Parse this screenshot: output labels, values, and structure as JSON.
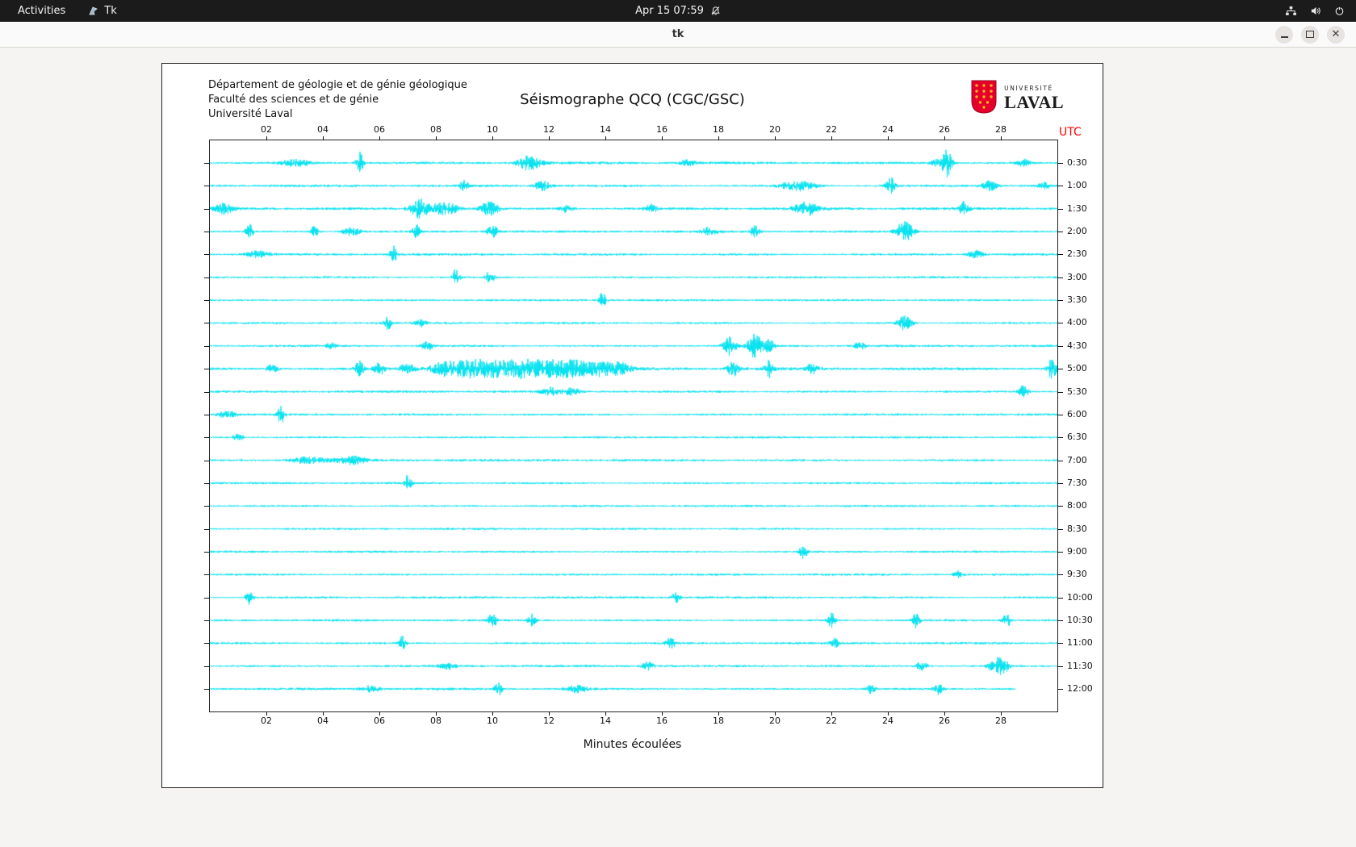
{
  "topbar": {
    "activities_label": "Activities",
    "app_menu_label": "Tk",
    "clock_label": "Apr 15 07:59"
  },
  "titlebar": {
    "title": "tk"
  },
  "seismograph": {
    "header_lines": [
      "Département de géologie et de génie géologique",
      "Faculté des sciences et de génie",
      "Université Laval"
    ],
    "title": "Séismographe QCQ (CGC/GSC)",
    "utc_label": "UTC",
    "x_axis_label": "Minutes écoulées",
    "x_ticks": [
      "02",
      "04",
      "06",
      "08",
      "10",
      "12",
      "14",
      "16",
      "18",
      "20",
      "22",
      "24",
      "26",
      "28"
    ],
    "trace_color": "#00e1ef",
    "logo": {
      "top_text": "UNIVERSITÉ",
      "bottom_text": "LAVAL"
    },
    "rows": [
      {
        "label": "0:30",
        "noise": 1.1,
        "end": 30,
        "spikes": [
          [
            3.0,
            4,
            0.5
          ],
          [
            5.3,
            14,
            0.12
          ],
          [
            11.3,
            9,
            0.4
          ],
          [
            16.9,
            3,
            0.3
          ],
          [
            25.9,
            7,
            0.3
          ],
          [
            26.1,
            12,
            0.15
          ],
          [
            28.8,
            5,
            0.2
          ]
        ]
      },
      {
        "label": "1:00",
        "noise": 1.0,
        "end": 30,
        "spikes": [
          [
            9.0,
            7,
            0.15
          ],
          [
            11.8,
            6,
            0.3
          ],
          [
            20.8,
            6,
            0.6
          ],
          [
            24.1,
            10,
            0.15
          ],
          [
            27.6,
            6,
            0.25
          ],
          [
            29.5,
            4,
            0.2
          ]
        ]
      },
      {
        "label": "1:30",
        "noise": 1.15,
        "end": 30,
        "spikes": [
          [
            0.5,
            6,
            0.3
          ],
          [
            7.4,
            12,
            0.3
          ],
          [
            8.3,
            8,
            0.5
          ],
          [
            9.9,
            9,
            0.3
          ],
          [
            12.6,
            5,
            0.25
          ],
          [
            15.6,
            5,
            0.2
          ],
          [
            21.1,
            8,
            0.4
          ],
          [
            26.7,
            9,
            0.15
          ]
        ]
      },
      {
        "label": "2:00",
        "noise": 1.0,
        "end": 30,
        "spikes": [
          [
            1.4,
            9,
            0.12
          ],
          [
            3.7,
            7,
            0.12
          ],
          [
            5.0,
            5,
            0.3
          ],
          [
            7.3,
            9,
            0.12
          ],
          [
            10.0,
            8,
            0.2
          ],
          [
            17.7,
            5,
            0.25
          ],
          [
            19.3,
            7,
            0.15
          ],
          [
            24.6,
            12,
            0.3
          ]
        ]
      },
      {
        "label": "2:30",
        "noise": 1.0,
        "end": 30,
        "spikes": [
          [
            1.7,
            4,
            0.4
          ],
          [
            6.5,
            10,
            0.12
          ],
          [
            27.1,
            5,
            0.25
          ]
        ]
      },
      {
        "label": "3:00",
        "noise": 0.9,
        "end": 30,
        "spikes": [
          [
            8.7,
            11,
            0.12
          ],
          [
            9.9,
            7,
            0.15
          ]
        ]
      },
      {
        "label": "3:30",
        "noise": 0.9,
        "end": 30,
        "spikes": [
          [
            13.9,
            10,
            0.12
          ]
        ]
      },
      {
        "label": "4:00",
        "noise": 0.9,
        "end": 30,
        "spikes": [
          [
            6.3,
            8,
            0.12
          ],
          [
            7.5,
            4,
            0.2
          ],
          [
            24.6,
            9,
            0.25
          ]
        ]
      },
      {
        "label": "4:30",
        "noise": 0.95,
        "end": 30,
        "spikes": [
          [
            4.3,
            5,
            0.15
          ],
          [
            7.7,
            5,
            0.2
          ],
          [
            18.4,
            13,
            0.2
          ],
          [
            19.3,
            15,
            0.25
          ],
          [
            19.8,
            9,
            0.15
          ],
          [
            23.0,
            4,
            0.2
          ]
        ]
      },
      {
        "label": "5:00",
        "noise": 1.25,
        "end": 30,
        "spikes": [
          [
            2.2,
            5,
            0.2
          ],
          [
            5.3,
            10,
            0.15
          ],
          [
            6.0,
            7,
            0.2
          ],
          [
            7.0,
            6,
            0.3
          ],
          [
            8.3,
            8,
            0.5
          ],
          [
            9.2,
            10,
            0.6
          ],
          [
            10.0,
            9,
            0.5
          ],
          [
            10.8,
            8,
            0.5
          ],
          [
            11.5,
            9,
            0.6
          ],
          [
            12.3,
            8,
            0.5
          ],
          [
            13.0,
            9,
            0.5
          ],
          [
            13.8,
            8,
            0.4
          ],
          [
            14.5,
            7,
            0.4
          ],
          [
            18.5,
            9,
            0.2
          ],
          [
            19.8,
            10,
            0.15
          ],
          [
            21.3,
            6,
            0.2
          ],
          [
            29.8,
            13,
            0.15
          ]
        ]
      },
      {
        "label": "5:30",
        "noise": 1.0,
        "end": 30,
        "spikes": [
          [
            12.0,
            5,
            0.3
          ],
          [
            12.8,
            4,
            0.3
          ],
          [
            28.8,
            9,
            0.15
          ]
        ]
      },
      {
        "label": "6:00",
        "noise": 0.95,
        "end": 30,
        "spikes": [
          [
            0.6,
            4,
            0.3
          ],
          [
            2.5,
            12,
            0.12
          ]
        ]
      },
      {
        "label": "6:30",
        "noise": 0.9,
        "end": 30,
        "spikes": [
          [
            1.0,
            4,
            0.2
          ]
        ]
      },
      {
        "label": "7:00",
        "noise": 1.0,
        "end": 30,
        "spikes": [
          [
            3.5,
            4,
            0.6
          ],
          [
            5.0,
            5,
            0.5
          ]
        ]
      },
      {
        "label": "7:30",
        "noise": 0.9,
        "end": 30,
        "spikes": [
          [
            7.0,
            10,
            0.12
          ]
        ]
      },
      {
        "label": "8:00",
        "noise": 0.85,
        "end": 30,
        "spikes": []
      },
      {
        "label": "8:30",
        "noise": 0.85,
        "end": 30,
        "spikes": []
      },
      {
        "label": "9:00",
        "noise": 0.9,
        "end": 30,
        "spikes": [
          [
            21.0,
            10,
            0.12
          ]
        ]
      },
      {
        "label": "9:30",
        "noise": 0.9,
        "end": 30,
        "spikes": [
          [
            26.5,
            4,
            0.15
          ]
        ]
      },
      {
        "label": "10:00",
        "noise": 0.9,
        "end": 30,
        "spikes": [
          [
            1.4,
            9,
            0.12
          ],
          [
            16.5,
            6,
            0.15
          ]
        ]
      },
      {
        "label": "10:30",
        "noise": 0.95,
        "end": 30,
        "spikes": [
          [
            10.0,
            8,
            0.15
          ],
          [
            11.4,
            7,
            0.15
          ],
          [
            22.0,
            11,
            0.12
          ],
          [
            25.0,
            9,
            0.12
          ],
          [
            28.2,
            8,
            0.15
          ]
        ]
      },
      {
        "label": "11:00",
        "noise": 0.95,
        "end": 30,
        "spikes": [
          [
            6.8,
            9,
            0.12
          ],
          [
            16.3,
            7,
            0.15
          ],
          [
            22.1,
            6,
            0.15
          ]
        ]
      },
      {
        "label": "11:30",
        "noise": 1.0,
        "end": 30,
        "spikes": [
          [
            8.4,
            4,
            0.3
          ],
          [
            15.5,
            5,
            0.2
          ],
          [
            25.2,
            5,
            0.2
          ],
          [
            27.8,
            9,
            0.25
          ],
          [
            28.1,
            7,
            0.2
          ]
        ]
      },
      {
        "label": "12:00",
        "noise": 1.0,
        "end": 28.5,
        "spikes": [
          [
            5.7,
            4,
            0.3
          ],
          [
            10.2,
            9,
            0.12
          ],
          [
            13.0,
            4,
            0.4
          ],
          [
            23.4,
            6,
            0.15
          ],
          [
            25.8,
            7,
            0.15
          ]
        ]
      }
    ]
  }
}
